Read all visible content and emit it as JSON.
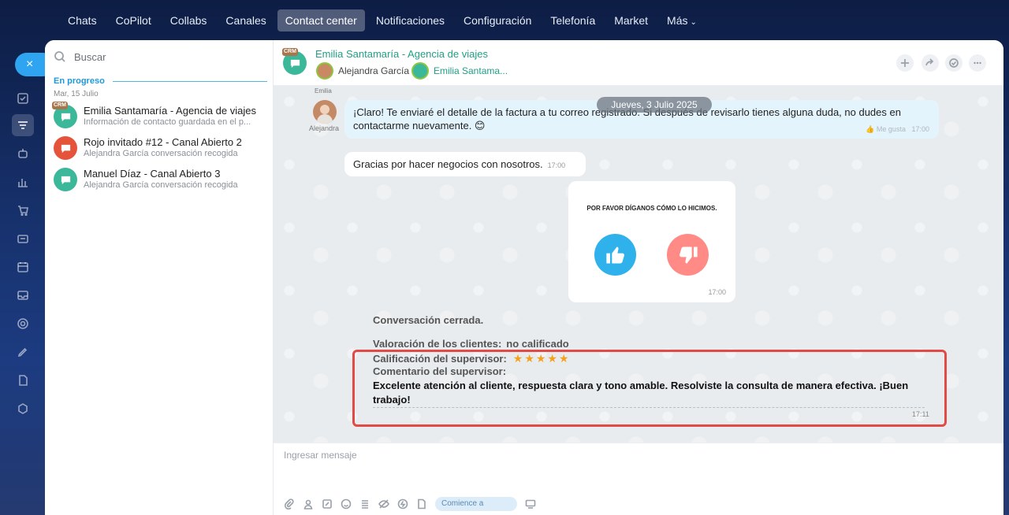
{
  "topnav": {
    "items": [
      "Chats",
      "CoPilot",
      "Collabs",
      "Canales",
      "Contact center",
      "Notificaciones",
      "Configuración",
      "Telefonía",
      "Market",
      "Más"
    ],
    "active": "Contact center"
  },
  "rail": {
    "close": "×",
    "icons": [
      "tasks-icon",
      "filter-icon",
      "robot-icon",
      "chart-icon",
      "cart-icon",
      "card-icon",
      "calendar-icon",
      "inbox-icon",
      "target-icon",
      "pen-icon",
      "document-icon",
      "cube-icon"
    ]
  },
  "list": {
    "search_placeholder": "Buscar",
    "section_title": "En progreso",
    "section_date": "Mar, 15 Julio",
    "conversations": [
      {
        "name": "Emilia Santamaría - Agencia de viajes",
        "sub": "Información de contacto guardada en el p...",
        "color": "#3bb89a",
        "crm": "CRM"
      },
      {
        "name": "Rojo invitado #12 - Canal Abierto 2",
        "sub": "Alejandra García conversación recogida",
        "color": "#e5543a"
      },
      {
        "name": "Manuel Díaz - Canal Abierto 3",
        "sub": "Alejandra García conversación recogida",
        "color": "#3bb89a"
      }
    ]
  },
  "chat": {
    "crm_badge": "CRM",
    "title": "Emilia Santamaría - Agencia de viajes",
    "participant1": "Alejandra García",
    "participant2": "Emilia Santama...",
    "emilia_tag": "Emilia",
    "date": "Jueves, 3 Julio 2025",
    "agent_name": "Alejandra",
    "msg1": "¡Claro! Te enviaré el detalle de la factura a tu correo registrado. Si después de revisarlo tienes alguna duda, no dudes en contactarme nuevamente. 😊",
    "msg1_like": "👍 Me gusta",
    "msg1_time": "17:00",
    "msg2": "Gracias por hacer negocios con nosotros.",
    "msg2_time": "17:00",
    "rating_question": "POR FAVOR DÍGANOS CÓMO LO HICIMOS.",
    "rating_time": "17:00",
    "closed": "Conversación cerrada.",
    "client_rating_label": "Valoración de los clientes:",
    "client_rating_value": "no calificado",
    "supervisor_rating_label": "Calificación del supervisor:",
    "supervisor_stars": "★★★★★",
    "supervisor_rating": 5,
    "supervisor_comment_label": "Comentario del supervisor:",
    "supervisor_comment": "Excelente atención al cliente, respuesta clara y tono amable. Resolviste la consulta de manera efectiva. ¡Buen trabajo!",
    "comment_time": "17:11",
    "composer_placeholder": "Ingresar mensaje",
    "start_label": "Comience a"
  },
  "colors": {
    "accent": "#2fa4f0",
    "highlight": "#e34a46",
    "star": "#f4a21b",
    "green": "#229e84"
  }
}
